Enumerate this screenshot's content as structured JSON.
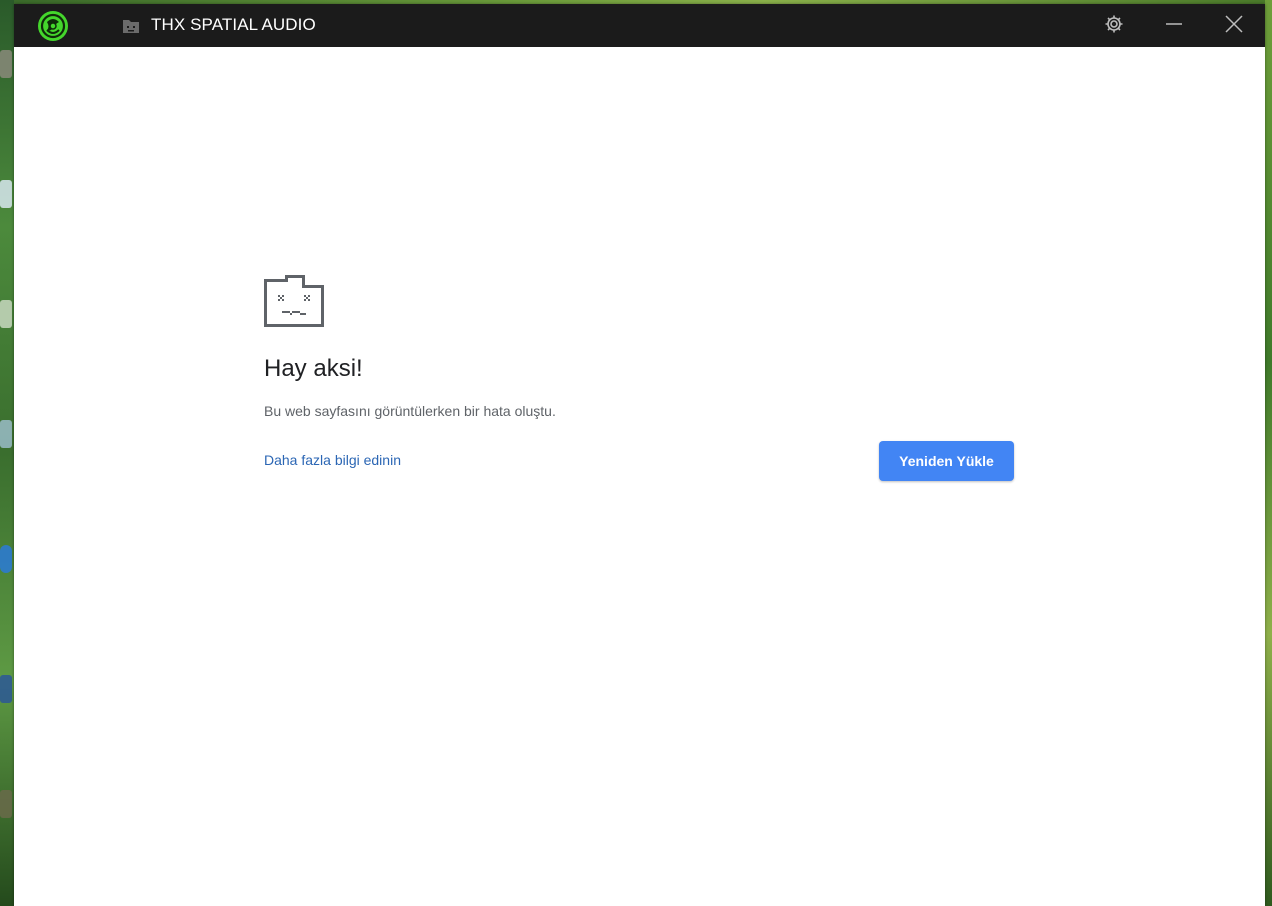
{
  "window": {
    "title": "THX SPATIAL AUDIO",
    "accent_color": "#44d62c",
    "titlebar_color": "#1b1b1b",
    "buttons": {
      "settings_icon": "gear-icon",
      "minimize_icon": "minimize-icon",
      "close_icon": "close-icon"
    }
  },
  "error_page": {
    "icon": "sad-tab-icon",
    "heading": "Hay aksi!",
    "description": "Bu web sayfasını görüntülerken bir hata oluştu.",
    "learn_more_label": "Daha fazla bilgi edinin",
    "reload_label": "Yeniden Yükle",
    "button_color": "#4285f4",
    "link_color": "#2b66b4"
  }
}
